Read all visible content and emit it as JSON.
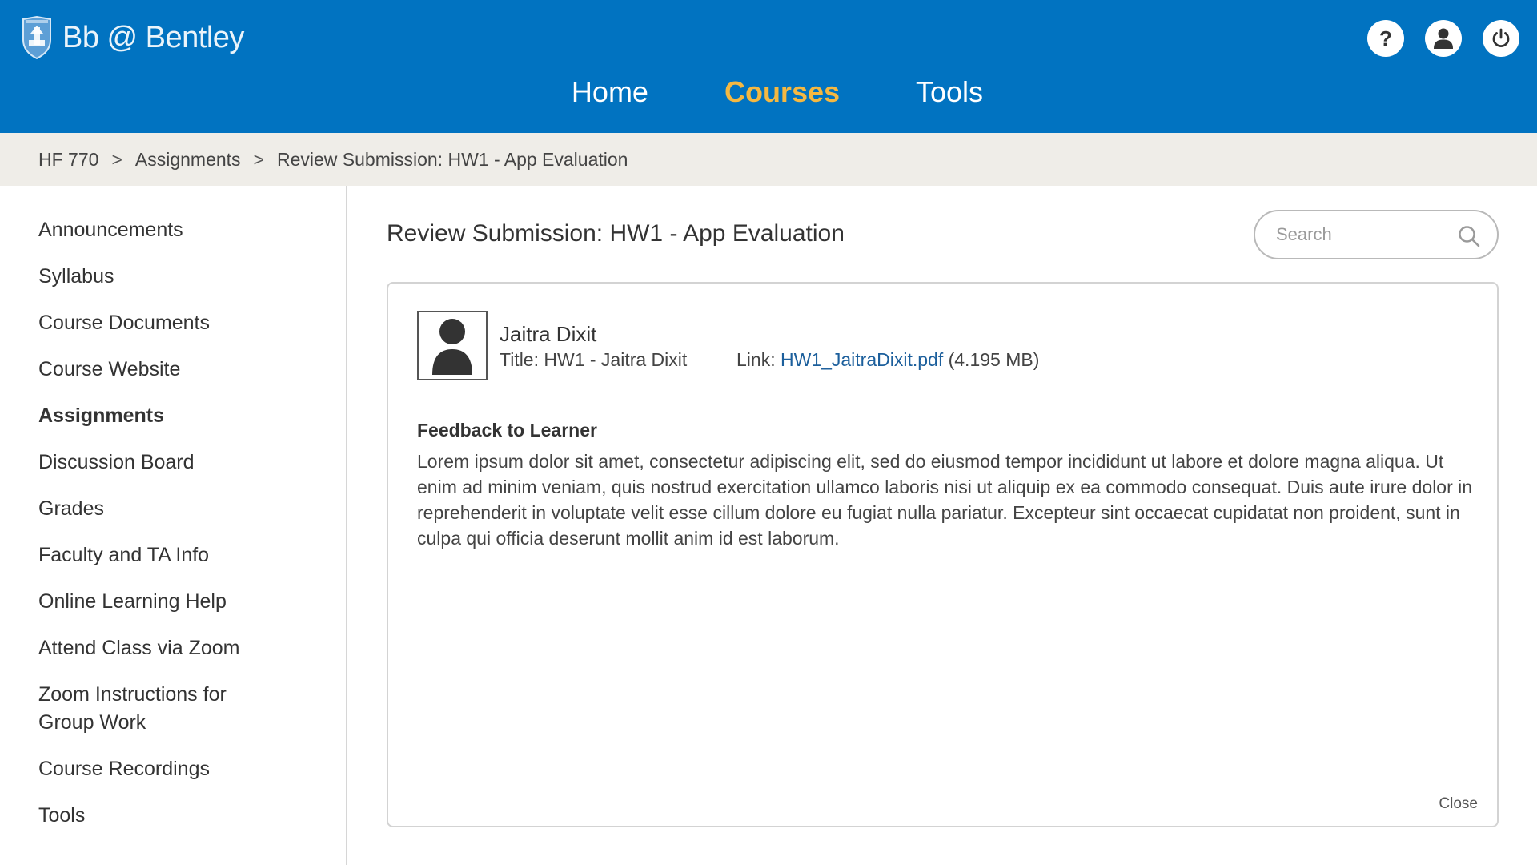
{
  "header": {
    "logo_text": "Bb @ Bentley",
    "brand_color": "#0173c1",
    "accent_color": "#f5b841",
    "icons": [
      "help-icon",
      "user-icon",
      "power-icon"
    ]
  },
  "nav": {
    "items": [
      {
        "label": "Home"
      },
      {
        "label": "Courses"
      },
      {
        "label": "Tools"
      }
    ],
    "active": "Courses"
  },
  "breadcrumb": {
    "items": [
      "HF 770",
      "Assignments",
      "Review Submission: HW1 - App Evaluation"
    ],
    "separator": ">"
  },
  "sidebar": {
    "items": [
      {
        "label": "Announcements"
      },
      {
        "label": "Syllabus"
      },
      {
        "label": "Course Documents"
      },
      {
        "label": "Course Website"
      },
      {
        "label": "Assignments"
      },
      {
        "label": "Discussion Board"
      },
      {
        "label": "Grades"
      },
      {
        "label": "Faculty and TA Info"
      },
      {
        "label": "Online Learning Help"
      },
      {
        "label": "Attend Class via Zoom"
      },
      {
        "label": "Zoom Instructions for Group Work"
      },
      {
        "label": "Course Recordings"
      },
      {
        "label": "Tools"
      }
    ],
    "active": "Assignments"
  },
  "main": {
    "title": "Review Submission: HW1 - App Evaluation",
    "search": {
      "placeholder": "Search",
      "value": ""
    },
    "submission": {
      "student_name": "Jaitra Dixit",
      "title_label": "Title: HW1 - Jaitra Dixit",
      "link_label": "Link: ",
      "file_name": "HW1_JaitraDixit.pdf",
      "file_size": " (4.195 MB)"
    },
    "feedback": {
      "label": "Feedback to Learner",
      "text": "Lorem ipsum dolor sit amet, consectetur adipiscing elit, sed do eiusmod tempor incididunt ut labore et dolore magna aliqua. Ut enim ad minim veniam, quis nostrud exercitation ullamco laboris nisi ut aliquip ex ea commodo consequat. Duis aute irure dolor in reprehenderit in voluptate velit esse cillum dolore eu fugiat nulla pariatur. Excepteur sint occaecat cupidatat non proident, sunt in culpa qui officia deserunt mollit anim id est laborum."
    },
    "close_label": "Close"
  }
}
